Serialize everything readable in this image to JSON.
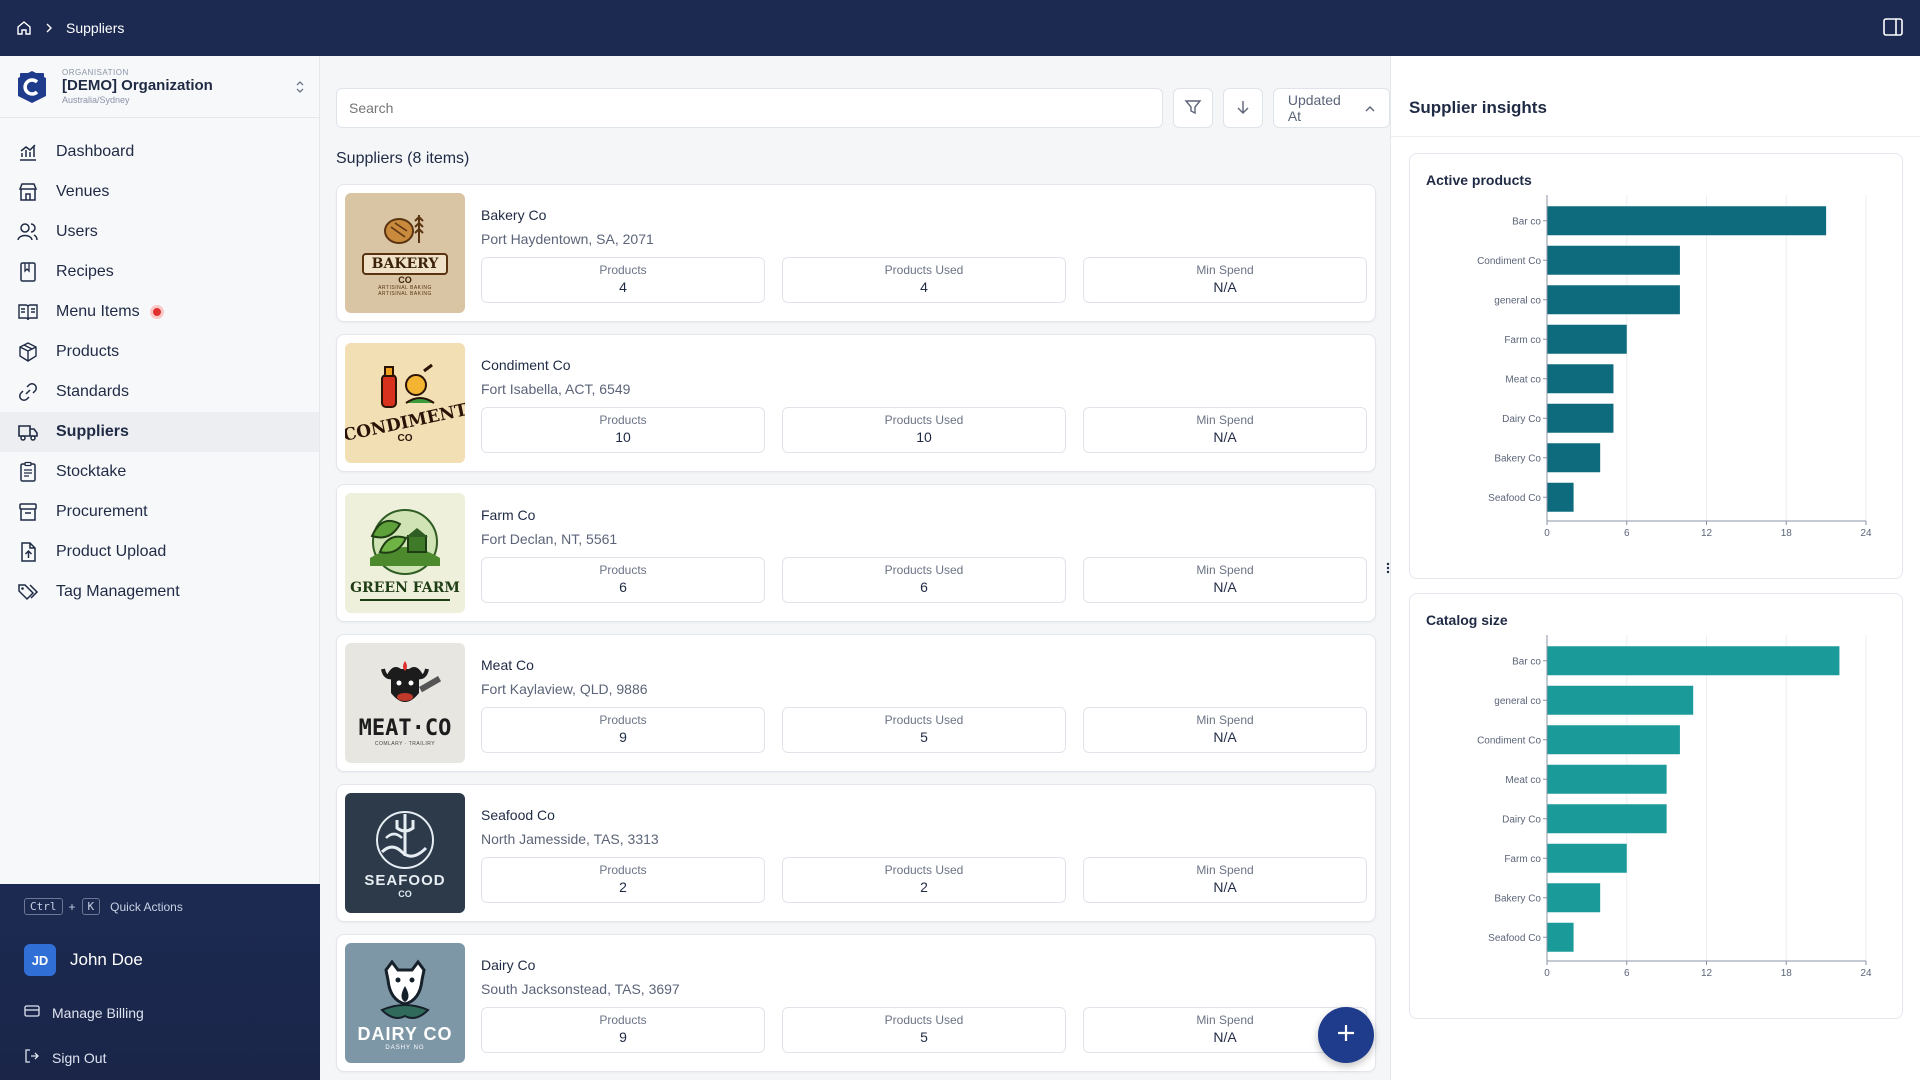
{
  "breadcrumb": {
    "current": "Suppliers"
  },
  "org": {
    "kicker": "ORGANISATION",
    "name": "[DEMO] Organization",
    "timezone": "Australia/Sydney"
  },
  "nav": {
    "dashboard": "Dashboard",
    "venues": "Venues",
    "users": "Users",
    "recipes": "Recipes",
    "menu_items": "Menu Items",
    "products": "Products",
    "standards": "Standards",
    "suppliers": "Suppliers",
    "stocktake": "Stocktake",
    "procurement": "Procurement",
    "product_upload": "Product Upload",
    "tag_management": "Tag Management"
  },
  "sidebar_bottom": {
    "kbd_ctrl": "Ctrl",
    "kbd_plus": "+",
    "kbd_k": "K",
    "quick_actions": "Quick Actions",
    "user_initials": "JD",
    "user_name": "John Doe",
    "manage_billing": "Manage Billing",
    "sign_out": "Sign Out"
  },
  "toolbar": {
    "search_placeholder": "Search",
    "sort_label": "Updated At"
  },
  "list": {
    "title": "Suppliers (8 items)"
  },
  "stat_labels": {
    "products": "Products",
    "products_used": "Products Used",
    "min_spend": "Min Spend"
  },
  "suppliers": [
    {
      "name": "Bakery Co",
      "address": "Port Haydentown, SA, 2071",
      "products": "4",
      "products_used": "4",
      "min_spend": "N/A",
      "logo": {
        "line1": "BAKERY",
        "line2": "CO",
        "line3": "ARTISINAL BAKING",
        "line4": "ARTISINAL BAKING"
      }
    },
    {
      "name": "Condiment Co",
      "address": "Fort Isabella, ACT, 6549",
      "products": "10",
      "products_used": "10",
      "min_spend": "N/A",
      "logo": {
        "line1": "CONDIMENT",
        "line2": "CO"
      }
    },
    {
      "name": "Farm Co",
      "address": "Fort Declan, NT, 5561",
      "products": "6",
      "products_used": "6",
      "min_spend": "N/A",
      "logo": {
        "line1": "GREEN FARM"
      }
    },
    {
      "name": "Meat Co",
      "address": "Fort Kaylaview, QLD, 9886",
      "products": "9",
      "products_used": "5",
      "min_spend": "N/A",
      "logo": {
        "line1": "MEAT·CO",
        "line2": "COMLARY · TRAILIRY"
      }
    },
    {
      "name": "Seafood Co",
      "address": "North Jamesside, TAS, 3313",
      "products": "2",
      "products_used": "2",
      "min_spend": "N/A",
      "logo": {
        "line1": "SEAFOOD",
        "line2": "CO"
      }
    },
    {
      "name": "Dairy Co",
      "address": "South Jacksonstead, TAS, 3697",
      "products": "9",
      "products_used": "5",
      "min_spend": "N/A",
      "logo": {
        "line1": "DAIRY CO",
        "line2": "DASHY NG"
      }
    }
  ],
  "insights": {
    "title": "Supplier insights"
  },
  "colors": {
    "active_bar": "#0e6b7d",
    "catalog_bar": "#1b9a9a",
    "topbar": "#1c2a52"
  },
  "chart_data": [
    {
      "type": "bar",
      "orientation": "horizontal",
      "title": "Active products",
      "categories": [
        "Bar co",
        "Condiment Co",
        "general co",
        "Farm co",
        "Meat co",
        "Dairy Co",
        "Bakery Co",
        "Seafood Co"
      ],
      "values": [
        21,
        10,
        10,
        6,
        5,
        5,
        4,
        2
      ],
      "xlim": [
        0,
        24
      ],
      "xticks": [
        0,
        6,
        12,
        18,
        24
      ]
    },
    {
      "type": "bar",
      "orientation": "horizontal",
      "title": "Catalog size",
      "categories": [
        "Bar co",
        "general co",
        "Condiment Co",
        "Meat co",
        "Dairy Co",
        "Farm co",
        "Bakery Co",
        "Seafood Co"
      ],
      "values": [
        22,
        11,
        10,
        9,
        9,
        6,
        4,
        2
      ],
      "xlim": [
        0,
        24
      ],
      "xticks": [
        0,
        6,
        12,
        18,
        24
      ]
    }
  ]
}
